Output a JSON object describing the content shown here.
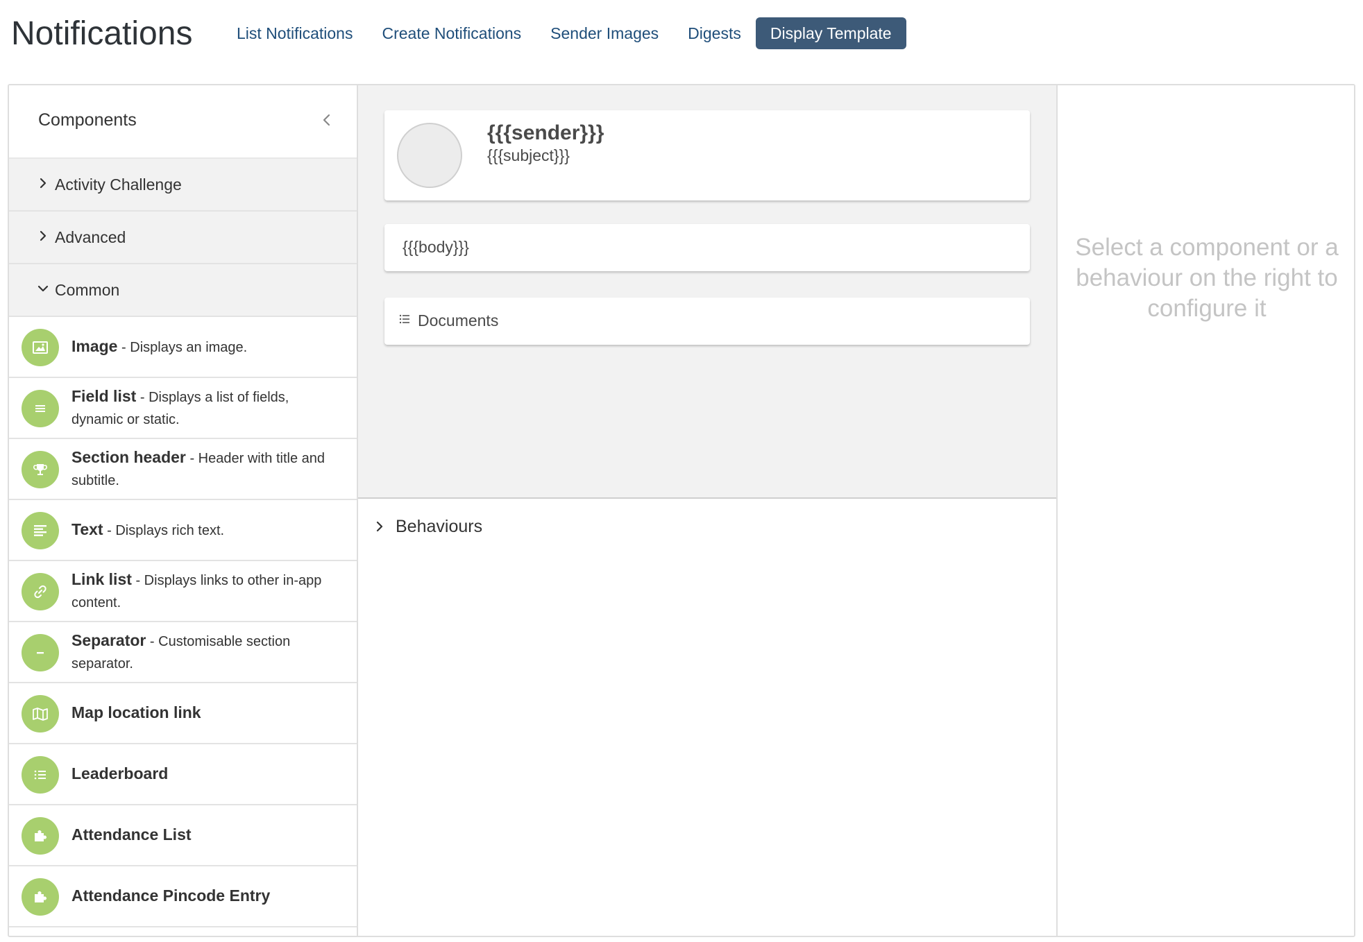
{
  "header": {
    "title": "Notifications",
    "nav": [
      {
        "label": "List Notifications",
        "active": false
      },
      {
        "label": "Create Notifications",
        "active": false
      },
      {
        "label": "Sender Images",
        "active": false
      },
      {
        "label": "Digests",
        "active": false
      },
      {
        "label": "Display Template",
        "active": true
      }
    ]
  },
  "sidebar": {
    "title": "Components",
    "sections": [
      {
        "label": "Activity Challenge",
        "expanded": false
      },
      {
        "label": "Advanced",
        "expanded": false
      },
      {
        "label": "Common",
        "expanded": true
      }
    ],
    "components": [
      {
        "name": "Image",
        "desc": " - Displays an image.",
        "icon": "image-icon"
      },
      {
        "name": "Field list",
        "desc": " - Displays a list of fields, dynamic or static.",
        "icon": "list-icon"
      },
      {
        "name": "Section header",
        "desc": " - Header with title and subtitle.",
        "icon": "trophy-icon"
      },
      {
        "name": "Text",
        "desc": " - Displays rich text.",
        "icon": "text-align-icon"
      },
      {
        "name": "Link list",
        "desc": " - Displays links to other in-app content.",
        "icon": "link-icon"
      },
      {
        "name": "Separator",
        "desc": " - Customisable section separator.",
        "icon": "minus-icon"
      },
      {
        "name": "Map location link",
        "desc": "",
        "icon": "map-icon"
      },
      {
        "name": "Leaderboard",
        "desc": "",
        "icon": "list-ol-icon"
      },
      {
        "name": "Attendance List",
        "desc": "",
        "icon": "puzzle-icon"
      },
      {
        "name": "Attendance Pincode Entry",
        "desc": "",
        "icon": "puzzle-icon"
      }
    ]
  },
  "canvas": {
    "sender": "{{{sender}}}",
    "subject": "{{{subject}}}",
    "body": "{{{body}}}",
    "documents": "Documents"
  },
  "behaviours": {
    "label": "Behaviours"
  },
  "config": {
    "hint": "Select a component or a behaviour on the right to configure it"
  },
  "colors": {
    "accent": "#3d5a78",
    "link": "#1f4e7a",
    "icon_bg": "#a8cf6e",
    "canvas_bg": "#f2f2f2",
    "hint_text": "#c4c4c4"
  }
}
